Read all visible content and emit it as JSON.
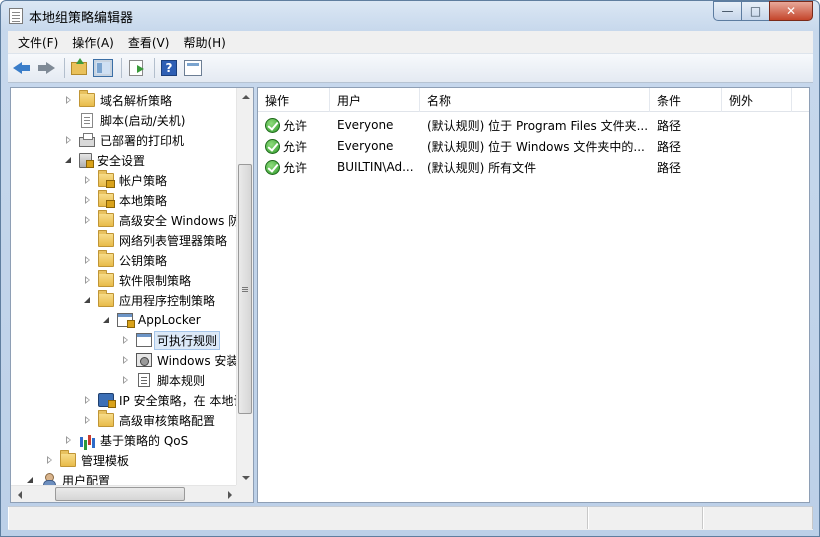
{
  "window": {
    "title": "本地组策略编辑器",
    "controls": {
      "minimize": "—",
      "maximize": "□",
      "close": "✕"
    }
  },
  "menu": [
    "文件(F)",
    "操作(A)",
    "查看(V)",
    "帮助(H)"
  ],
  "toolbar": {
    "icons": [
      "back-arrow-icon",
      "forward-arrow-icon",
      "up-folder-icon",
      "show-hide-tree-icon",
      "export-list-icon",
      "help-icon",
      "properties-icon"
    ],
    "help_glyph": "?"
  },
  "tree": [
    {
      "label": "域名解析策略",
      "level": 2,
      "expander": "closed",
      "icon": "folder"
    },
    {
      "label": "脚本(启动/关机)",
      "level": 2,
      "expander": "none",
      "icon": "doc"
    },
    {
      "label": "已部署的打印机",
      "level": 2,
      "expander": "closed",
      "icon": "printer"
    },
    {
      "label": "安全设置",
      "level": 2,
      "expander": "open",
      "icon": "shield"
    },
    {
      "label": "帐户策略",
      "level": 3,
      "expander": "closed",
      "icon": "folder-lock"
    },
    {
      "label": "本地策略",
      "level": 3,
      "expander": "closed",
      "icon": "folder-lock"
    },
    {
      "label": "高级安全 Windows 防",
      "level": 3,
      "expander": "closed",
      "icon": "folder"
    },
    {
      "label": "网络列表管理器策略",
      "level": 3,
      "expander": "none",
      "icon": "folder"
    },
    {
      "label": "公钥策略",
      "level": 3,
      "expander": "closed",
      "icon": "folder"
    },
    {
      "label": "软件限制策略",
      "level": 3,
      "expander": "closed",
      "icon": "folder"
    },
    {
      "label": "应用程序控制策略",
      "level": 3,
      "expander": "open",
      "icon": "folder"
    },
    {
      "label": "AppLocker",
      "level": 4,
      "expander": "open",
      "icon": "applocker"
    },
    {
      "label": "可执行规则",
      "level": 5,
      "expander": "closed",
      "icon": "window",
      "selected": true
    },
    {
      "label": "Windows 安装",
      "level": 5,
      "expander": "closed",
      "icon": "installer"
    },
    {
      "label": "脚本规则",
      "level": 5,
      "expander": "closed",
      "icon": "script"
    },
    {
      "label": "IP 安全策略，在 本地计",
      "level": 3,
      "expander": "closed",
      "icon": "ipsec"
    },
    {
      "label": "高级审核策略配置",
      "level": 3,
      "expander": "closed",
      "icon": "folder"
    },
    {
      "label": "基于策略的 QoS",
      "level": 2,
      "expander": "closed",
      "icon": "qos"
    },
    {
      "label": "管理模板",
      "level": 1,
      "expander": "closed",
      "icon": "folder"
    },
    {
      "label": "用户配置",
      "level": 0,
      "expander": "open",
      "icon": "user"
    }
  ],
  "list": {
    "columns": [
      "操作",
      "用户",
      "名称",
      "条件",
      "例外"
    ],
    "rows": [
      {
        "action": "允许",
        "user": "Everyone",
        "name": "(默认规则) 位于 Program Files 文件夹...",
        "condition": "路径",
        "exception": ""
      },
      {
        "action": "允许",
        "user": "Everyone",
        "name": "(默认规则) 位于 Windows 文件夹中的...",
        "condition": "路径",
        "exception": ""
      },
      {
        "action": "允许",
        "user": "BUILTIN\\Ad...",
        "name": "(默认规则) 所有文件",
        "condition": "路径",
        "exception": ""
      }
    ]
  },
  "colors": {
    "accent": "#3a7dc9",
    "selection": "#dce9f7",
    "allow": "#2f9a2a"
  }
}
